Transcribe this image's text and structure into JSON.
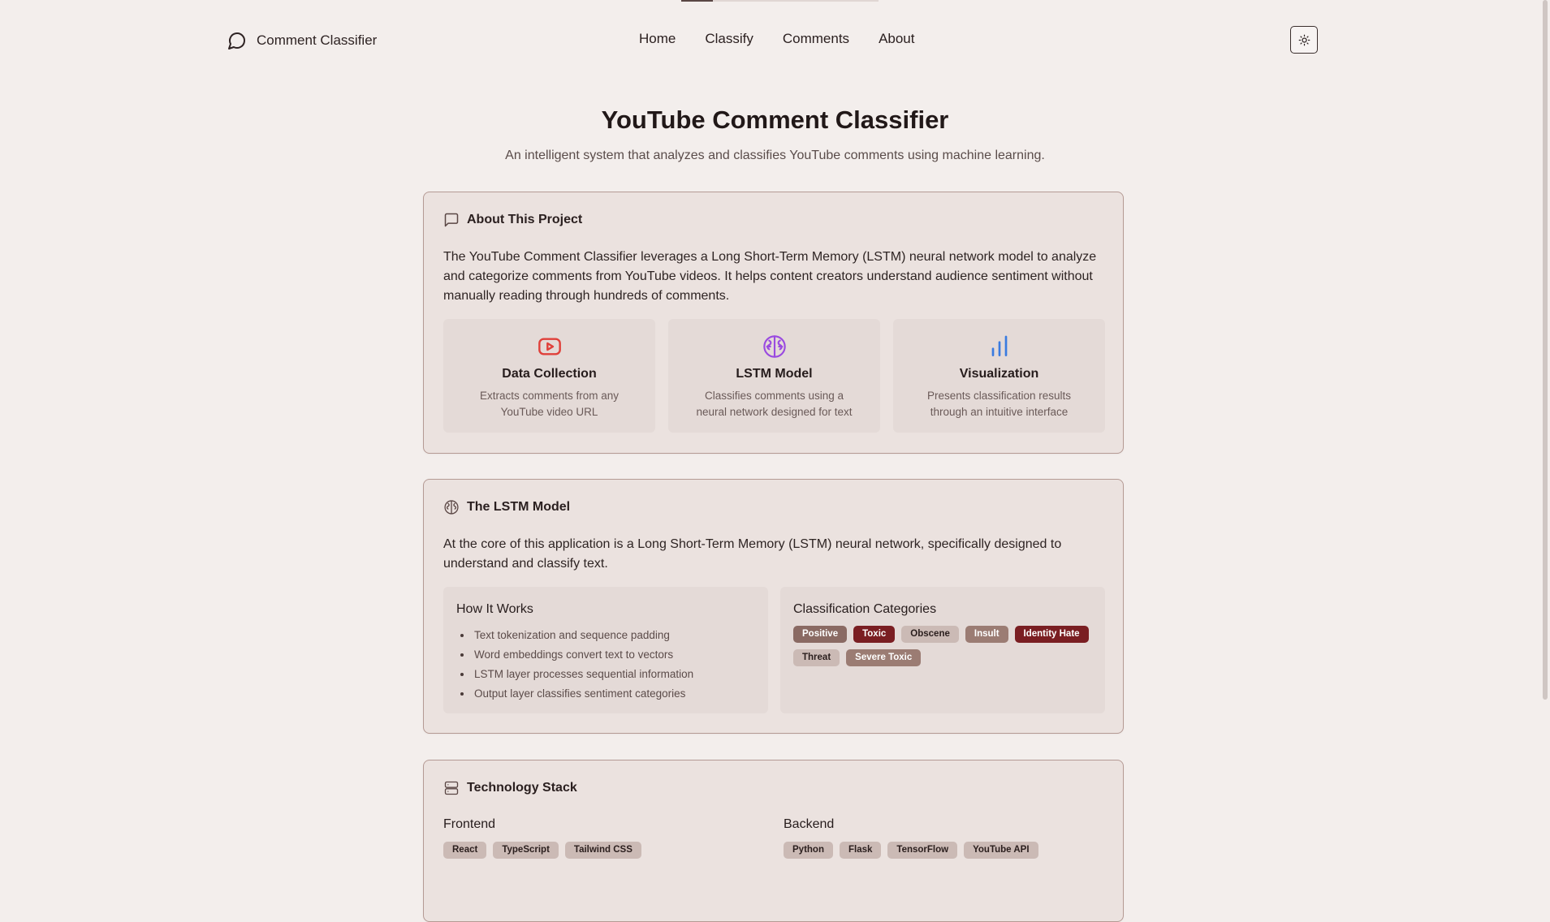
{
  "top_progress": {
    "fraction": 0.16
  },
  "header": {
    "brand_name": "Comment Classifier",
    "brand_icon": "message-circle-icon",
    "nav": [
      {
        "label": "Home"
      },
      {
        "label": "Classify"
      },
      {
        "label": "Comments"
      },
      {
        "label": "About"
      }
    ],
    "theme_toggle_icon": "sun-icon"
  },
  "hero": {
    "title": "YouTube Comment Classifier",
    "subtitle": "An intelligent system that analyzes and classifies YouTube comments using machine learning."
  },
  "about_card": {
    "icon": "message-square-icon",
    "heading": "About This Project",
    "body": "The YouTube Comment Classifier leverages a Long Short-Term Memory (LSTM) neural network model to analyze and categorize comments from YouTube videos. It helps content creators understand audience sentiment without manually reading through hundreds of comments.",
    "features": [
      {
        "icon": "youtube-icon",
        "title": "Data Collection",
        "desc": "Extracts comments from any YouTube video URL",
        "color": "#e0403a"
      },
      {
        "icon": "brain-icon",
        "title": "LSTM Model",
        "desc": "Classifies comments using a neural network designed for text",
        "color": "#9a4ae0"
      },
      {
        "icon": "bar-chart-icon",
        "title": "Visualization",
        "desc": "Presents classification results through an intuitive interface",
        "color": "#3a7be0"
      }
    ]
  },
  "lstm_card": {
    "icon": "brain-icon",
    "heading": "The LSTM Model",
    "body": "At the core of this application is a Long Short-Term Memory (LSTM) neural network, specifically designed to understand and classify text.",
    "how_it_works": {
      "heading": "How It Works",
      "items": [
        "Text tokenization and sequence padding",
        "Word embeddings convert text to vectors",
        "LSTM layer processes sequential information",
        "Output layer classifies sentiment categories"
      ]
    },
    "categories": {
      "heading": "Classification Categories",
      "items": [
        {
          "label": "Positive",
          "bg": "#8a6a63",
          "fg": "#ffffff"
        },
        {
          "label": "Toxic",
          "bg": "#7a1e22",
          "fg": "#ffffff"
        },
        {
          "label": "Obscene",
          "bg": "#cbbab5",
          "fg": "#2a1e1d"
        },
        {
          "label": "Insult",
          "bg": "#9b7c73",
          "fg": "#ffffff"
        },
        {
          "label": "Identity Hate",
          "bg": "#7a1e22",
          "fg": "#ffffff"
        },
        {
          "label": "Threat",
          "bg": "#cbbab5",
          "fg": "#2a1e1d"
        },
        {
          "label": "Severe Toxic",
          "bg": "#9b7c73",
          "fg": "#ffffff"
        }
      ]
    }
  },
  "tech_card": {
    "icon": "server-icon",
    "heading": "Technology Stack",
    "frontend": {
      "heading": "Frontend",
      "items": [
        "React",
        "TypeScript",
        "Tailwind CSS"
      ]
    },
    "backend": {
      "heading": "Backend",
      "items": [
        "Python",
        "Flask",
        "TensorFlow",
        "YouTube API"
      ]
    },
    "tag_bg": "#cbbab5"
  }
}
